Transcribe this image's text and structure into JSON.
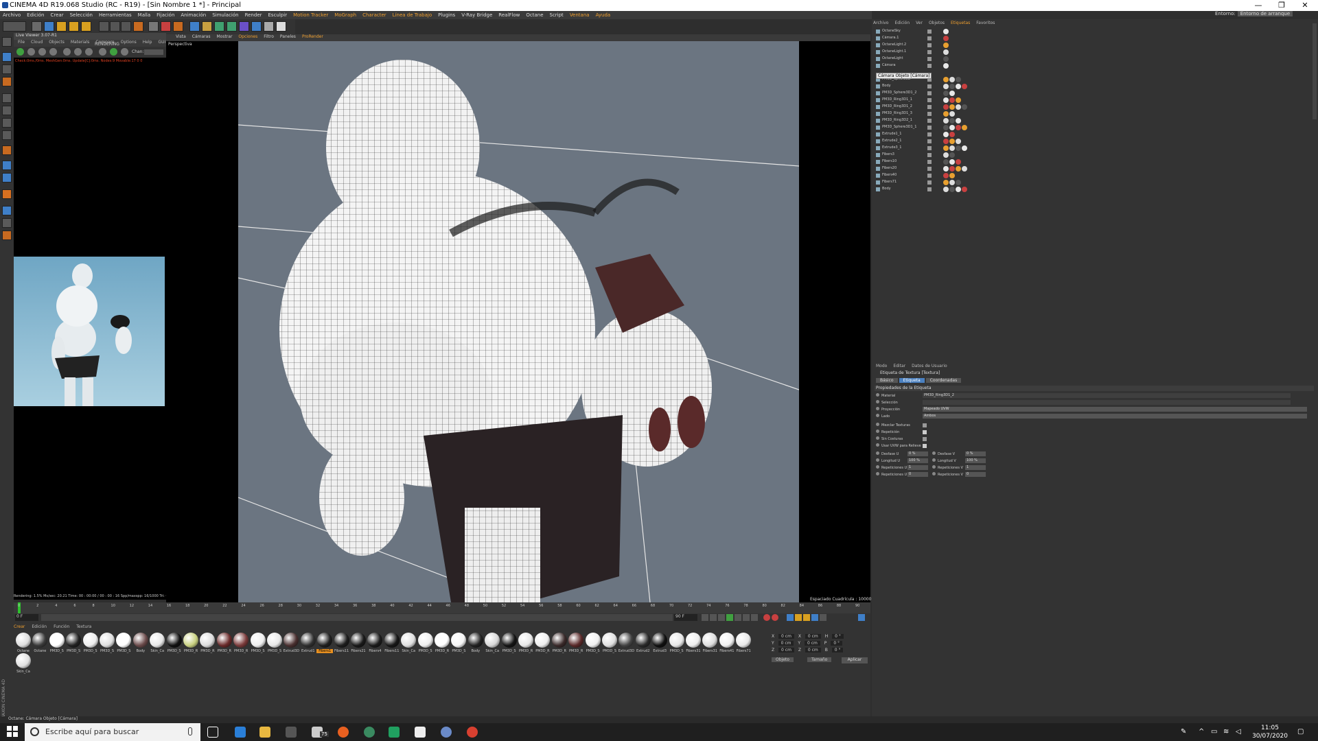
{
  "window": {
    "title": "CINEMA 4D R19.068 Studio (RC - R19) - [Sin Nombre 1 *] - Principal",
    "min": "—",
    "max": "❐",
    "close": "✕"
  },
  "menubar": [
    "Archivo",
    "Edición",
    "Crear",
    "Selección",
    "Herramientas",
    "Malla",
    "Fijación",
    "Animación",
    "Simulación",
    "Render",
    "Esculpir",
    "Motion Tracker",
    "MoGraph",
    "Character",
    "Línea de Trabajo",
    "Plugins",
    "V-Ray Bridge",
    "RealFlow",
    "Octane",
    "Script",
    "Ventana",
    "Ayuda"
  ],
  "layout": {
    "label": "Entorno:",
    "value": "Entorno de arranque"
  },
  "liveviewer": {
    "title": "Live Viewer 3.07-R1",
    "menu": [
      "File",
      "Cloud",
      "Objects",
      "Materials",
      "Compare",
      "Options",
      "Help",
      "GUI"
    ],
    "mode": "RENDERING",
    "channel": "Chan:",
    "status": "Check:0ms./0ms. MeshGen:0ms. Update[C]:0ms. Nodes:9 Movable:17  0 0",
    "footer": "Rendering: 1.5%   Ms/sec: 20.21   Time: 00 : 00:00 / 00 : 00 : 16   Spp/maxspp: 16/1000   Tri: 0/0"
  },
  "viewport": {
    "menu": [
      "Vista",
      "Cámaras",
      "Mostrar",
      "Opciones",
      "Filtro",
      "Paneles",
      "ProRender"
    ],
    "label": "Perspectiva",
    "grid": "Espaciado Cuadrícula : 10000 cm"
  },
  "timeline": {
    "ticks": [
      "0",
      "2",
      "4",
      "6",
      "8",
      "10",
      "12",
      "14",
      "16",
      "18",
      "20",
      "22",
      "24",
      "26",
      "28",
      "30",
      "32",
      "34",
      "36",
      "38",
      "40",
      "42",
      "44",
      "46",
      "48",
      "50",
      "52",
      "54",
      "56",
      "58",
      "60",
      "62",
      "64",
      "66",
      "68",
      "70",
      "72",
      "74",
      "76",
      "78",
      "80",
      "82",
      "84",
      "86",
      "88",
      "90"
    ],
    "frame_start": "0 F",
    "frame_current": "0 F",
    "frame_end": "90 F",
    "frame_max": "90 F",
    "frame_total": "0 F"
  },
  "materials": {
    "menu": [
      "Crear",
      "Edición",
      "Función",
      "Textura"
    ],
    "items": [
      {
        "name": "Octane",
        "color": "#dddddd"
      },
      {
        "name": "Octane",
        "color": "#3a3a3a"
      },
      {
        "name": "PM3D_S",
        "color": "#ffffff"
      },
      {
        "name": "PM3D_S",
        "color": "#222222"
      },
      {
        "name": "PM3D_S",
        "color": "#eeeeee"
      },
      {
        "name": "PM3D_S",
        "color": "#e0e0e0"
      },
      {
        "name": "PM3D_S",
        "color": "#ffffff"
      },
      {
        "name": "Body",
        "color": "#6a4a4a"
      },
      {
        "name": "Skin_Ca",
        "color": "#e8e8e8"
      },
      {
        "name": "PM3D_S",
        "color": "#111111"
      },
      {
        "name": "PM3D_R",
        "color": "#c8d080"
      },
      {
        "name": "PM3D_R",
        "color": "#dddddd"
      },
      {
        "name": "PM3D_R",
        "color": "#6a2a2a"
      },
      {
        "name": "PM3D_R",
        "color": "#7a3a3a"
      },
      {
        "name": "PM3D_S",
        "color": "#f0f0f0"
      },
      {
        "name": "PM3D_S",
        "color": "#e8e8e8"
      },
      {
        "name": "Extrud3D",
        "color": "#4a3030"
      },
      {
        "name": "Extrud1",
        "color": "#303030"
      },
      {
        "name": "Fibers1",
        "color": "#202020"
      },
      {
        "name": "Fibers11",
        "color": "#1e1e1e"
      },
      {
        "name": "Fibers21",
        "color": "#1a1a1a"
      },
      {
        "name": "Fibers4",
        "color": "#1c1c1c"
      },
      {
        "name": "Fibers11",
        "color": "#181818"
      },
      {
        "name": "Skin_Ca",
        "color": "#e0e0e0"
      },
      {
        "name": "PM3D_S",
        "color": "#eeeeee"
      },
      {
        "name": "PM3D_R",
        "color": "#ffffff"
      },
      {
        "name": "PM3D_S",
        "color": "#f6f6f6"
      },
      {
        "name": "Body",
        "color": "#222222"
      },
      {
        "name": "Skin_Ca",
        "color": "#d8d8d8"
      },
      {
        "name": "PM3D_S",
        "color": "#151515"
      },
      {
        "name": "PM3D_R",
        "color": "#e8e8e8"
      },
      {
        "name": "PM3D_R",
        "color": "#eeeeee"
      },
      {
        "name": "PM3D_R",
        "color": "#3a2a2a"
      },
      {
        "name": "PM3D_R",
        "color": "#5a2a2a"
      },
      {
        "name": "PM3D_S",
        "color": "#f0f0f0"
      },
      {
        "name": "PM3D_S",
        "color": "#e0e0e0"
      },
      {
        "name": "Extrud3D",
        "color": "#444444"
      },
      {
        "name": "Extrud2",
        "color": "#2a2a2a"
      },
      {
        "name": "Extrud3",
        "color": "#111111"
      },
      {
        "name": "PM3D_S",
        "color": "#e8e8e8"
      },
      {
        "name": "Fibers31",
        "color": "#eeeeee"
      },
      {
        "name": "Fibers31",
        "color": "#dddddd"
      },
      {
        "name": "Fibers41",
        "color": "#f0f0f0"
      },
      {
        "name": "Fibers71",
        "color": "#e8e8e8"
      },
      {
        "name": "Skin_Ca",
        "color": "#e0e0e0"
      }
    ],
    "selected_index": 18
  },
  "coords": {
    "rows": [
      {
        "a": "X",
        "v1": "0 cm",
        "b": "X",
        "v2": "0 cm",
        "c": "H",
        "v3": "0 °"
      },
      {
        "a": "Y",
        "v1": "0 cm",
        "b": "Y",
        "v2": "0 cm",
        "c": "P",
        "v3": "0 °"
      },
      {
        "a": "Z",
        "v1": "0 cm",
        "b": "Z",
        "v2": "0 cm",
        "c": "B",
        "v3": "0 °"
      }
    ],
    "mode1": "Objeto",
    "mode2": "Tamaño",
    "apply": "Aplicar"
  },
  "statusbar": "Octane:   Cámara Objeto [Cámara]",
  "objects": {
    "menu": [
      "Archivo",
      "Edición",
      "Ver",
      "Objetos",
      "Etiquetas",
      "Favoritos"
    ],
    "rows": [
      "OctaneSky",
      "Cámara.1",
      "OctaneLight.2",
      "OctaneLight.1",
      "OctaneLight",
      "Cámara",
      "Cámara Objeto [Cámara]",
      "PM3D_Sphere3D",
      "Body",
      "PM3D_Sphere3D1_2",
      "PM3D_Ring3D1_1",
      "PM3D_Ring3D1_2",
      "PM3D_Ring3D1_3",
      "PM3D_Ring3D2_1",
      "PM3D_Sphere3D1_1",
      "Extrude1_1",
      "Extrude2_1",
      "Extrude3_1",
      "Fibers3",
      "Fibers10",
      "Fibers20",
      "Fibers40",
      "Fibers71",
      "Body"
    ],
    "tooltip": "Cámara Objeto [Cámara]"
  },
  "attributes": {
    "menu": [
      "Modo",
      "Editar",
      "Datos de Usuario"
    ],
    "title": "Etiqueta de Textura [Textura]",
    "tabs": [
      "Básico",
      "Etiqueta",
      "Coordenadas"
    ],
    "active_tab": 1,
    "section": "Propiedades de la Etiqueta",
    "material_label": "Material",
    "material_value": "PM3D_Ring3D1_2",
    "selection_label": "Selección",
    "projection_label": "Proyección",
    "projection_value": "Mapeado UVW",
    "side_label": "Lado",
    "side_value": "Ambos",
    "add_label": "Mezclar Texturas",
    "tile_label": "Repetición",
    "seamless_label": "Sin Costuras",
    "uvw_label": "Usar UVW para Relieve",
    "offset_u_label": "Desfase U",
    "offset_u": "0 %",
    "offset_v_label": "Desfase V",
    "offset_v": "0 %",
    "length_u_label": "Longitud U",
    "length_u": "100 %",
    "length_v_label": "Longitud V",
    "length_v": "100 %",
    "tiles_u_label": "Repeticiones U",
    "tiles_u": "1",
    "tiles_v_label": "Repeticiones V",
    "tiles_v": "1",
    "rep_u_label": "Repeticiones U",
    "rep_u": "0",
    "rep_v_label": "Repeticiones V",
    "rep_v": "0"
  },
  "taskbar": {
    "search": "Escribe aquí para buscar",
    "time": "11:05",
    "date": "30/07/2020",
    "badge": "75"
  }
}
